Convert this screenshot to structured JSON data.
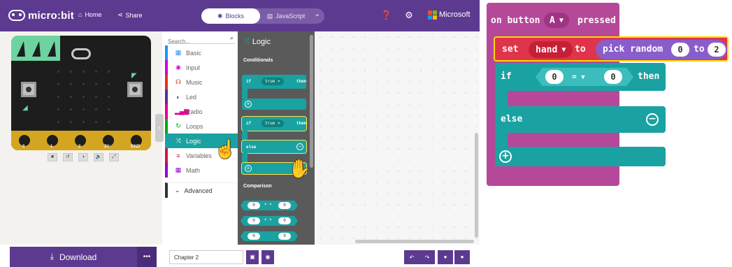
{
  "header": {
    "brand": "micro:bit",
    "home_label": "Home",
    "share_label": "Share",
    "blocks_label": "Blocks",
    "javascript_label": "JavaScript",
    "microsoft_label": "Microsoft",
    "colors": {
      "bar": "#5c3a8f",
      "accent": "#1aa2a2"
    }
  },
  "simulator": {
    "pins": [
      "0",
      "1",
      "2",
      "3V",
      "GND"
    ],
    "controls": [
      "■",
      "↺",
      "◑",
      "🔈",
      "⤢"
    ]
  },
  "toolbox": {
    "search_placeholder": "Search...",
    "categories": [
      {
        "label": "Basic",
        "icon": "grid-icon",
        "glyph": "▦",
        "color": "#1e90ff"
      },
      {
        "label": "Input",
        "icon": "target-icon",
        "glyph": "◉",
        "color": "#d400d4"
      },
      {
        "label": "Music",
        "icon": "headphones-icon",
        "glyph": "☊",
        "color": "#e63022"
      },
      {
        "label": "Led",
        "icon": "toggle-icon",
        "glyph": "◐",
        "color": "#5c2d91"
      },
      {
        "label": "Radio",
        "icon": "signal-icon",
        "glyph": "▂▄▆",
        "color": "#e3008c"
      },
      {
        "label": "Loops",
        "icon": "loop-icon",
        "glyph": "↻",
        "color": "#00aa00"
      },
      {
        "label": "Logic",
        "icon": "shuffle-icon",
        "glyph": "⤨",
        "color": "#1aa2a2"
      },
      {
        "label": "Variables",
        "icon": "list-icon",
        "glyph": "≡",
        "color": "#dc143c"
      },
      {
        "label": "Math",
        "icon": "calculator-icon",
        "glyph": "▦",
        "color": "#9400d3"
      }
    ],
    "active_index": 6,
    "advanced_label": "Advanced"
  },
  "flyout": {
    "title": "Logic",
    "section_conditionals": "Conditionals",
    "section_comparison": "Comparison",
    "if_label": "if",
    "then_label": "then",
    "else_label": "else",
    "true_label": "true ▾",
    "cmp_rows": [
      {
        "a": "0",
        "op": "= ▾",
        "b": "0"
      },
      {
        "a": "0",
        "op": "< ▾",
        "b": "0"
      },
      {
        "a": "0",
        "op": "",
        "b": "0"
      }
    ]
  },
  "bottombar": {
    "download_label": "Download",
    "more_label": "•••",
    "project_name": "Chapter 2"
  },
  "code": {
    "event_prefix": "on button",
    "event_button": "A",
    "event_suffix": "pressed",
    "set_label": "set",
    "set_var": "hand",
    "to_label": "to",
    "random_label": "pick random",
    "random_from": "0",
    "random_to_label": "to",
    "random_to": "2",
    "if_label": "if",
    "cond_left": "0",
    "cond_op": "=",
    "cond_right": "0",
    "then_label": "then",
    "else_label": "else"
  }
}
